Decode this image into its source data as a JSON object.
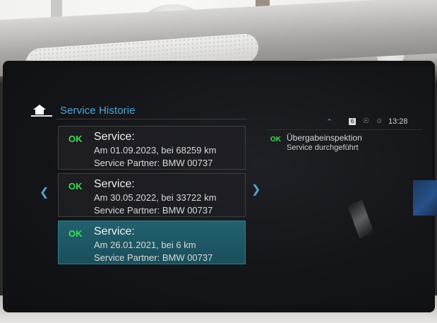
{
  "header": {
    "title": "Service Historie",
    "home_icon": "home-icon"
  },
  "status_bar": {
    "chevron_icon": "chevron-up-icon",
    "badge": "6",
    "speaker_icon": "speaker-icon",
    "user_icon": "user-icon",
    "time": "13:28"
  },
  "service_history": [
    {
      "status": "OK",
      "title": "Service:",
      "line1": "Am 01.09.2023, bei 68259 km",
      "line2": "Service Partner: BMW 00737",
      "selected": false
    },
    {
      "status": "OK",
      "title": "Service:",
      "line1": "Am 30.05.2022, bei 33722 km",
      "line2": "Service Partner: BMW 00737",
      "selected": false
    },
    {
      "status": "OK",
      "title": "Service:",
      "line1": "Am 26.01.2021, bei 6 km",
      "line2": "Service Partner: BMW 00737",
      "selected": true
    }
  ],
  "detail": {
    "status": "OK",
    "title": "Übergabeinspektion",
    "subtitle": "Service durchgeführt"
  },
  "nav": {
    "left_icon": "chevron-left-icon",
    "right_icon": "chevron-right-icon"
  },
  "colors": {
    "accent": "#4fa6d6",
    "ok_green": "#37e04f",
    "selected_bg": "#1f5866"
  }
}
